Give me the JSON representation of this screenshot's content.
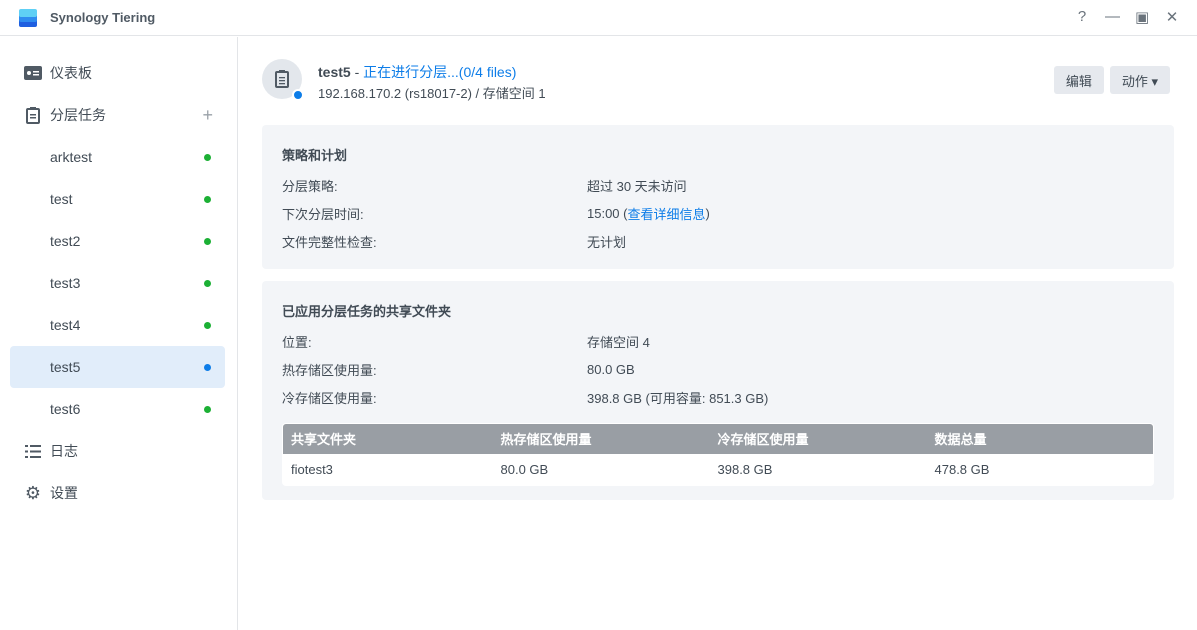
{
  "app": {
    "title": "Synology Tiering",
    "help": "?",
    "minimize": "—",
    "maximize": "▣",
    "close": "✕"
  },
  "sidebar": {
    "dashboard": "仪表板",
    "tasks": "分层任务",
    "add": "+",
    "task_items": [
      "arktest",
      "test",
      "test2",
      "test3",
      "test4",
      "test5",
      "test6"
    ],
    "selected": "test5",
    "log": "日志",
    "settings": "设置"
  },
  "header": {
    "name": "test5",
    "sep": " - ",
    "status": "正在进行分层...(0/4 files)",
    "sub": "192.168.170.2 (rs18017-2) / 存储空间 1",
    "edit": "编辑",
    "action": "动作 ▾"
  },
  "policy": {
    "title": "策略和计划",
    "rows": [
      {
        "k": "分层策略:",
        "v": "超过 30 天未访问"
      },
      {
        "k": "下次分层时间:",
        "v": "15:00 (",
        "link": " 查看详细信息 ",
        "after": ")"
      },
      {
        "k": "文件完整性检查:",
        "v": "无计划"
      }
    ]
  },
  "shared": {
    "title": "已应用分层任务的共享文件夹",
    "rows": [
      {
        "k": "位置:",
        "v": "存储空间 4"
      },
      {
        "k": "热存储区使用量:",
        "v": "80.0 GB"
      },
      {
        "k": "冷存储区使用量:",
        "v": "398.8 GB (可用容量: 851.3 GB)"
      }
    ],
    "table": {
      "headers": [
        "共享文件夹",
        "热存储区使用量",
        "冷存储区使用量",
        "数据总量"
      ],
      "rows": [
        [
          "fiotest3",
          "80.0 GB",
          "398.8 GB",
          "478.8 GB"
        ]
      ]
    }
  }
}
